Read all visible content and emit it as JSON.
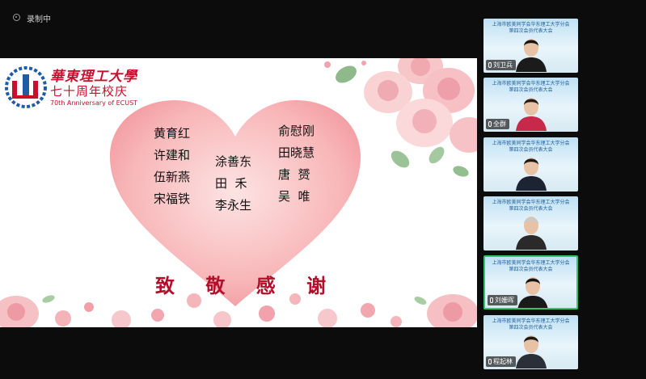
{
  "recording": {
    "label": "录制中"
  },
  "slide": {
    "logo": {
      "title": "華東理工大學",
      "subtitle": "七十周年校庆",
      "english": "70th Anniversary of ECUST",
      "years_left": "1952",
      "years_right": "2022"
    },
    "names_col1": [
      "黄育红",
      "许建和",
      "伍新燕",
      "宋福铁"
    ],
    "names_col2": [
      "涂善东",
      "田  禾",
      "李永生"
    ],
    "names_col3": [
      "俞慰刚",
      "田晓慧",
      "唐  赟",
      "吴  唯"
    ],
    "thanks": "致 敬 感 谢"
  },
  "participants": [
    {
      "name": "刘卫兵",
      "banner": [
        "上海市欧美同学会华东理工大学分会",
        "第四次会员代表大会"
      ],
      "shirt": "#1b1b1b",
      "hair": "#141414",
      "active": false
    },
    {
      "name": "全群",
      "banner": [
        "上海市欧美同学会华东理工大学分会",
        "第四次会员代表大会"
      ],
      "shirt": "#c8284a",
      "hair": "#2a1a14",
      "active": false
    },
    {
      "name": "",
      "banner": [
        "上海市欧美同学会华东理工大学分会",
        "第四次会员代表大会"
      ],
      "shirt": "#1c2433",
      "hair": "#1a1a1a",
      "active": false
    },
    {
      "name": "",
      "banner": [
        "上海市欧美同学会华东理工大学分会",
        "第四次会员代表大会"
      ],
      "shirt": "#2a2a2a",
      "hair": "#c9c9c9",
      "active": false
    },
    {
      "name": "刘姗晖",
      "banner": [
        "上海市欧美同学会华东理工大学分会",
        "第四次会员代表大会"
      ],
      "shirt": "#1a1a1a",
      "hair": "#141414",
      "active": true
    },
    {
      "name": "程起林",
      "banner": [
        "上海市欧美同学会华东理工大学分会",
        "第四次会员代表大会"
      ],
      "shirt": "#2b2f38",
      "hair": "#1a1a1a",
      "active": false
    }
  ]
}
